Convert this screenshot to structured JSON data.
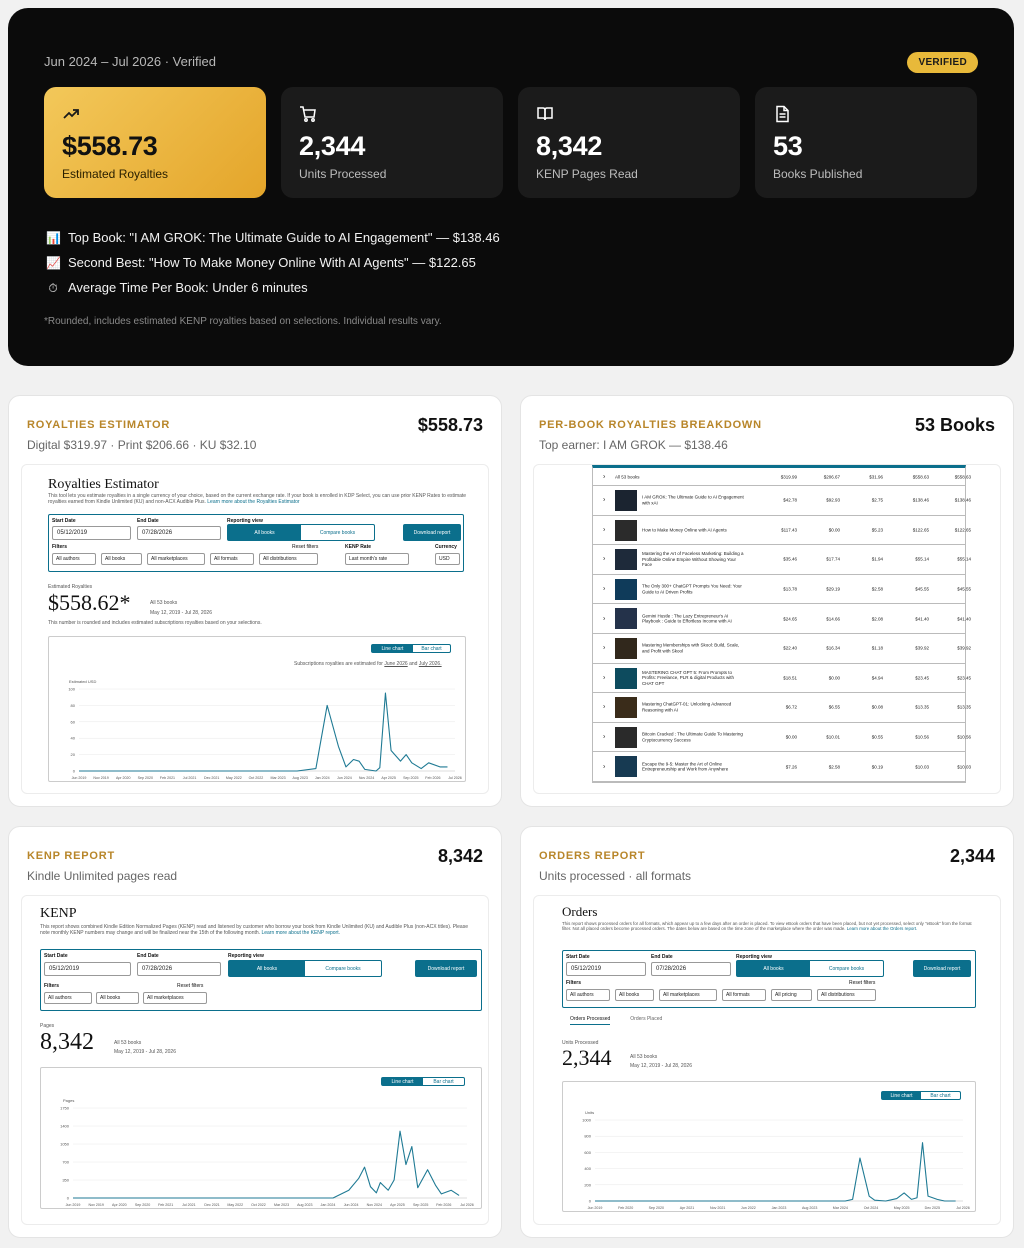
{
  "hero": {
    "period": "Jun 2024 – Jul 2026 · Verified",
    "badge": "VERIFIED",
    "stats": [
      {
        "icon": "trending-up-icon",
        "value": "$558.73",
        "label": "Estimated Royalties"
      },
      {
        "icon": "shopping-cart-icon",
        "value": "2,344",
        "label": "Units Processed"
      },
      {
        "icon": "open-book-icon",
        "value": "8,342",
        "label": "KENP Pages Read"
      },
      {
        "icon": "document-icon",
        "value": "53",
        "label": "Books Published"
      }
    ],
    "highlights": [
      {
        "emoji": "📊",
        "text": "Top Book: \"I AM GROK: The Ultimate Guide to AI Engagement\" — $138.46"
      },
      {
        "emoji": "📈",
        "text": "Second Best: \"How To Make Money Online With AI Agents\" — $122.65"
      },
      {
        "emoji": "⏱",
        "text": "Average Time Per Book: Under 6 minutes"
      }
    ],
    "note": "*Rounded, includes estimated KENP royalties based on selections. Individual results vary."
  },
  "cards": {
    "royalties": {
      "title": "ROYALTIES ESTIMATOR",
      "value": "$558.73",
      "subtitle": "Digital $319.97 · Print $206.66 · KU $32.10",
      "shot": {
        "heading": "Royalties Estimator",
        "desc1": "This tool lets you estimate royalties in a single currency of your choice, based on the current exchange rate. If your book is enrolled in KDP Select, you can use prior KENP Rates to estimate royalties",
        "desc2": "earned from Kindle Unlimited (KU) and non-ACX Audible Plus.",
        "desc_link": "Learn more about the Royalties Estimator",
        "start_label": "Start Date",
        "end_label": "End Date",
        "view_label": "Reporting view",
        "start": "05/12/2019",
        "end": "07/28/2026",
        "all_books": "All books",
        "compare": "Compare books",
        "download": "Download report",
        "filters_label": "Filters",
        "reset": "Reset filters",
        "kenp_rate_label": "KENP Rate",
        "currency_label": "Currency",
        "f1": "All authors",
        "f2": "All books",
        "f3": "All marketplaces",
        "f4": "All formats",
        "f5": "All distributions",
        "kenp_rate": "Last month's rate",
        "currency": "USD",
        "est_label": "Estimated Royalties",
        "big": "$558.62*",
        "books": "All 53 books",
        "range": "May 12, 2019 - Jul 28, 2026",
        "rounded": "This number is rounded and includes estimated subscriptions royalties based on your selections.",
        "line_chart": "Line chart",
        "bar_chart": "Bar chart",
        "sub_note": "Subscriptions royalties are estimated for",
        "june": "June 2026",
        "and": "and",
        "july": "July 2026.",
        "yaxis": "Estimated USD"
      }
    },
    "perbook": {
      "title": "PER-BOOK ROYALTIES BREAKDOWN",
      "value": "53 Books",
      "subtitle": "Top earner: I AM GROK — $138.46",
      "all_label": "All 53 books",
      "all_vals": [
        "$319.99",
        "$206.67",
        "$31.96",
        "$558.63",
        "$558.63"
      ],
      "rows": [
        {
          "title": "I AM GROK: The Ultimate Guide to AI Engagement with xAI",
          "vals": [
            "$42.78",
            "$92.93",
            "$2.75",
            "$138.46",
            "$138.46"
          ],
          "cover": "#1b2430"
        },
        {
          "title": "How to Make Money Online with AI Agents",
          "vals": [
            "$117.43",
            "$0.00",
            "$5.23",
            "$122.65",
            "$122.65"
          ],
          "cover": "#2b2b2b"
        },
        {
          "title": "Mastering the Art of Faceless Marketing: Building a Profitable Online Empire Without Showing Your Face",
          "vals": [
            "$35.46",
            "$17.74",
            "$1.94",
            "$55.14",
            "$55.14"
          ],
          "cover": "#1e2a3a"
        },
        {
          "title": "The Only 300+ ChatGPT Prompts You Need: Your Guide to AI Driven Profits",
          "vals": [
            "$13.78",
            "$29.19",
            "$2.58",
            "$45.55",
            "$45.55"
          ],
          "cover": "#0f3b5a"
        },
        {
          "title": "Gemini Hustle : The Lazy Entrepreneur's AI Playbook : Guide to Effortless Income with AI",
          "vals": [
            "$24.65",
            "$14.66",
            "$2.08",
            "$41.40",
            "$41.40"
          ],
          "cover": "#24324a"
        },
        {
          "title": "Mastering Memberships with Skool: Build, Scale, and Profit with Skool",
          "vals": [
            "$22.40",
            "$16.34",
            "$1.18",
            "$39.92",
            "$39.92"
          ],
          "cover": "#31281c"
        },
        {
          "title": "MASTERING CHAT GPT 5: From Prompts to Profits: Freelance, PLR & digital Products with CHAT GPT",
          "vals": [
            "$18.51",
            "$0.00",
            "$4.94",
            "$23.45",
            "$23.45"
          ],
          "cover": "#0d4b5e"
        },
        {
          "title": "Mastering ChatGPT-01: Unlocking Advanced Reasoning with AI",
          "vals": [
            "$6.72",
            "$6.55",
            "$0.08",
            "$13.35",
            "$13.35"
          ],
          "cover": "#3a2c1a"
        },
        {
          "title": "Bitcoin Cracked : The Ultimate Guide To Mastering Cryptocurrency Success",
          "vals": [
            "$0.00",
            "$10.01",
            "$0.55",
            "$10.56",
            "$10.56"
          ],
          "cover": "#2a2a2a"
        },
        {
          "title": "Escape the 9-5: Master the Art of Online Entrepreneurship and Work from Anywhere",
          "vals": [
            "$7.26",
            "$2.58",
            "$0.19",
            "$10.03",
            "$10.03"
          ],
          "cover": "#173a52"
        }
      ]
    },
    "kenp": {
      "title": "KENP REPORT",
      "value": "8,342",
      "subtitle": "Kindle Unlimited pages read",
      "shot": {
        "heading": "KENP",
        "desc1": "This report shows combined Kindle Edition Normalized Pages (KENP) read and listened by customer who borrow your book from Kindle Unlimited (KU) and Audible Plus (non-ACX titles). Please note",
        "desc2": "monthly KENP numbers may change and will be finalized near the 15th of the following month.",
        "desc_link": "Learn more about the KENP report.",
        "start_label": "Start Date",
        "end_label": "End Date",
        "view_label": "Reporting view",
        "start": "05/12/2019",
        "end": "07/28/2026",
        "all_books": "All books",
        "compare": "Compare books",
        "download": "Download report",
        "filters_label": "Filters",
        "reset": "Reset filters",
        "f1": "All authors",
        "f2": "All books",
        "f3": "All marketplaces",
        "pages_label": "Pages",
        "big": "8,342",
        "books": "All 53 books",
        "range": "May 12, 2019 - Jul 28, 2026",
        "line_chart": "Line chart",
        "bar_chart": "Bar chart",
        "yaxis": "Pages"
      }
    },
    "orders": {
      "title": "ORDERS REPORT",
      "value": "2,344",
      "subtitle": "Units processed · all formats",
      "shot": {
        "heading": "Orders",
        "desc1": "This report shows processed orders for all formats, which appear up to a few days after an order is placed. To view eBook orders that have been placed, but not yet processed, select only \"eBook\"",
        "desc2": "from the format filter. Not all placed orders become processed orders. The dates below are based on the time zone of the marketplace where the order was made.",
        "desc_link": "Learn more about the Orders report.",
        "start_label": "Start Date",
        "end_label": "End Date",
        "view_label": "Reporting view",
        "start": "05/12/2019",
        "end": "07/28/2026",
        "all_books": "All books",
        "compare": "Compare books",
        "download": "Download report",
        "filters_label": "Filters",
        "reset": "Reset filters",
        "f1": "All authors",
        "f2": "All books",
        "f3": "All marketplaces",
        "f4": "All formats",
        "f5": "All pricing",
        "f6": "All distributions",
        "tab1": "Orders Processed",
        "tab2": "Orders Placed",
        "units_label": "Units Processed",
        "big": "2,344",
        "books": "All 53 books",
        "range": "May 12, 2019 - Jul 28, 2026",
        "line_chart": "Line chart",
        "bar_chart": "Bar chart",
        "yaxis": "Units"
      }
    }
  },
  "chart_data": [
    {
      "type": "line",
      "ylabel": "Estimated USD",
      "ylim": [
        0,
        100
      ],
      "yticks": [
        "0",
        "20",
        "40",
        "60",
        "80",
        "100"
      ],
      "x": [
        "Jun 2019",
        "Nov 2019",
        "Apr 2020",
        "Sep 2020",
        "Feb 2021",
        "Jul 2021",
        "Dec 2021",
        "May 2022",
        "Oct 2022",
        "Mar 2023",
        "Aug 2023",
        "Jan 2024",
        "Jun 2024",
        "Nov 2024",
        "Apr 2025",
        "Sep 2025",
        "Feb 2026",
        "Jul 2026"
      ],
      "series": [
        {
          "points": [
            [
              0,
              0
            ],
            [
              0.58,
              0
            ],
            [
              0.63,
              3
            ],
            [
              0.66,
              80
            ],
            [
              0.69,
              30
            ],
            [
              0.71,
              5
            ],
            [
              0.73,
              14
            ],
            [
              0.745,
              12
            ],
            [
              0.76,
              2
            ],
            [
              0.79,
              0
            ],
            [
              0.8,
              4
            ],
            [
              0.815,
              95
            ],
            [
              0.83,
              25
            ],
            [
              0.855,
              12
            ],
            [
              0.87,
              20
            ],
            [
              0.885,
              10
            ],
            [
              0.91,
              3
            ],
            [
              0.93,
              10
            ],
            [
              0.96,
              5
            ],
            [
              0.98,
              5
            ]
          ]
        }
      ]
    },
    {
      "type": "line",
      "ylabel": "Pages",
      "ylim": [
        0,
        1750
      ],
      "yticks": [
        "0",
        "350",
        "700",
        "1050",
        "1400",
        "1750"
      ],
      "x": [
        "Jun 2019",
        "Nov 2019",
        "Apr 2020",
        "Sep 2020",
        "Feb 2021",
        "Jul 2021",
        "Dec 2021",
        "May 2022",
        "Oct 2022",
        "Mar 2023",
        "Aug 2023",
        "Jan 2024",
        "Jun 2024",
        "Nov 2024",
        "Apr 2025",
        "Sep 2025",
        "Feb 2026",
        "Jul 2026"
      ],
      "series": [
        {
          "points": [
            [
              0,
              0
            ],
            [
              0.66,
              0
            ],
            [
              0.7,
              150
            ],
            [
              0.725,
              380
            ],
            [
              0.74,
              600
            ],
            [
              0.755,
              220
            ],
            [
              0.77,
              100
            ],
            [
              0.78,
              300
            ],
            [
              0.8,
              150
            ],
            [
              0.815,
              350
            ],
            [
              0.83,
              1300
            ],
            [
              0.845,
              650
            ],
            [
              0.86,
              1000
            ],
            [
              0.875,
              200
            ],
            [
              0.9,
              550
            ],
            [
              0.92,
              250
            ],
            [
              0.935,
              80
            ],
            [
              0.96,
              150
            ],
            [
              0.98,
              50
            ]
          ]
        }
      ]
    },
    {
      "type": "line",
      "ylabel": "Units",
      "ylim": [
        0,
        1000
      ],
      "yticks": [
        "0",
        "200",
        "400",
        "600",
        "800",
        "1000"
      ],
      "x": [
        "Jun 2019",
        "Feb 2020",
        "Sep 2020",
        "Apr 2021",
        "Nov 2021",
        "Jun 2022",
        "Jan 2023",
        "Aug 2023",
        "Mar 2024",
        "Oct 2024",
        "May 2025",
        "Dec 2025",
        "Jul 2026"
      ],
      "series": [
        {
          "points": [
            [
              0,
              0
            ],
            [
              0.68,
              0
            ],
            [
              0.7,
              20
            ],
            [
              0.72,
              530
            ],
            [
              0.745,
              60
            ],
            [
              0.76,
              10
            ],
            [
              0.79,
              0
            ],
            [
              0.82,
              30
            ],
            [
              0.84,
              100
            ],
            [
              0.86,
              20
            ],
            [
              0.875,
              40
            ],
            [
              0.89,
              720
            ],
            [
              0.905,
              60
            ],
            [
              0.93,
              20
            ],
            [
              0.95,
              0
            ],
            [
              0.98,
              0
            ]
          ]
        }
      ]
    }
  ]
}
